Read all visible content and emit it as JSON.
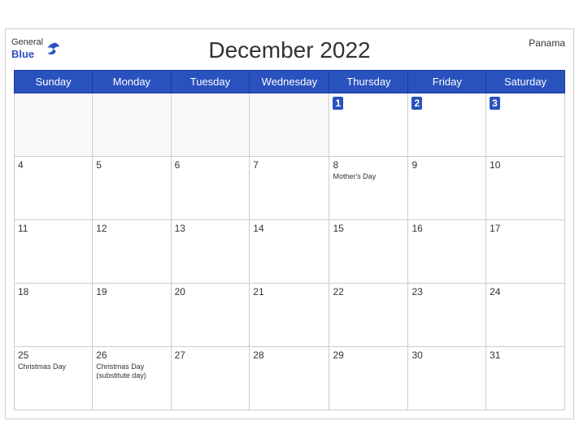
{
  "header": {
    "title": "December 2022",
    "country": "Panama",
    "logo_general": "General",
    "logo_blue": "Blue"
  },
  "days_of_week": [
    "Sunday",
    "Monday",
    "Tuesday",
    "Wednesday",
    "Thursday",
    "Friday",
    "Saturday"
  ],
  "weeks": [
    [
      {
        "day": "",
        "event": "",
        "empty": true
      },
      {
        "day": "",
        "event": "",
        "empty": true
      },
      {
        "day": "",
        "event": "",
        "empty": true
      },
      {
        "day": "",
        "event": "",
        "empty": true
      },
      {
        "day": "1",
        "event": ""
      },
      {
        "day": "2",
        "event": ""
      },
      {
        "day": "3",
        "event": ""
      }
    ],
    [
      {
        "day": "4",
        "event": ""
      },
      {
        "day": "5",
        "event": ""
      },
      {
        "day": "6",
        "event": ""
      },
      {
        "day": "7",
        "event": ""
      },
      {
        "day": "8",
        "event": "Mother's Day"
      },
      {
        "day": "9",
        "event": ""
      },
      {
        "day": "10",
        "event": ""
      }
    ],
    [
      {
        "day": "11",
        "event": ""
      },
      {
        "day": "12",
        "event": ""
      },
      {
        "day": "13",
        "event": ""
      },
      {
        "day": "14",
        "event": ""
      },
      {
        "day": "15",
        "event": ""
      },
      {
        "day": "16",
        "event": ""
      },
      {
        "day": "17",
        "event": ""
      }
    ],
    [
      {
        "day": "18",
        "event": ""
      },
      {
        "day": "19",
        "event": ""
      },
      {
        "day": "20",
        "event": ""
      },
      {
        "day": "21",
        "event": ""
      },
      {
        "day": "22",
        "event": ""
      },
      {
        "day": "23",
        "event": ""
      },
      {
        "day": "24",
        "event": ""
      }
    ],
    [
      {
        "day": "25",
        "event": "Christmas Day"
      },
      {
        "day": "26",
        "event": "Christmas Day\n(substitute day)"
      },
      {
        "day": "27",
        "event": ""
      },
      {
        "day": "28",
        "event": ""
      },
      {
        "day": "29",
        "event": ""
      },
      {
        "day": "30",
        "event": ""
      },
      {
        "day": "31",
        "event": ""
      }
    ]
  ]
}
